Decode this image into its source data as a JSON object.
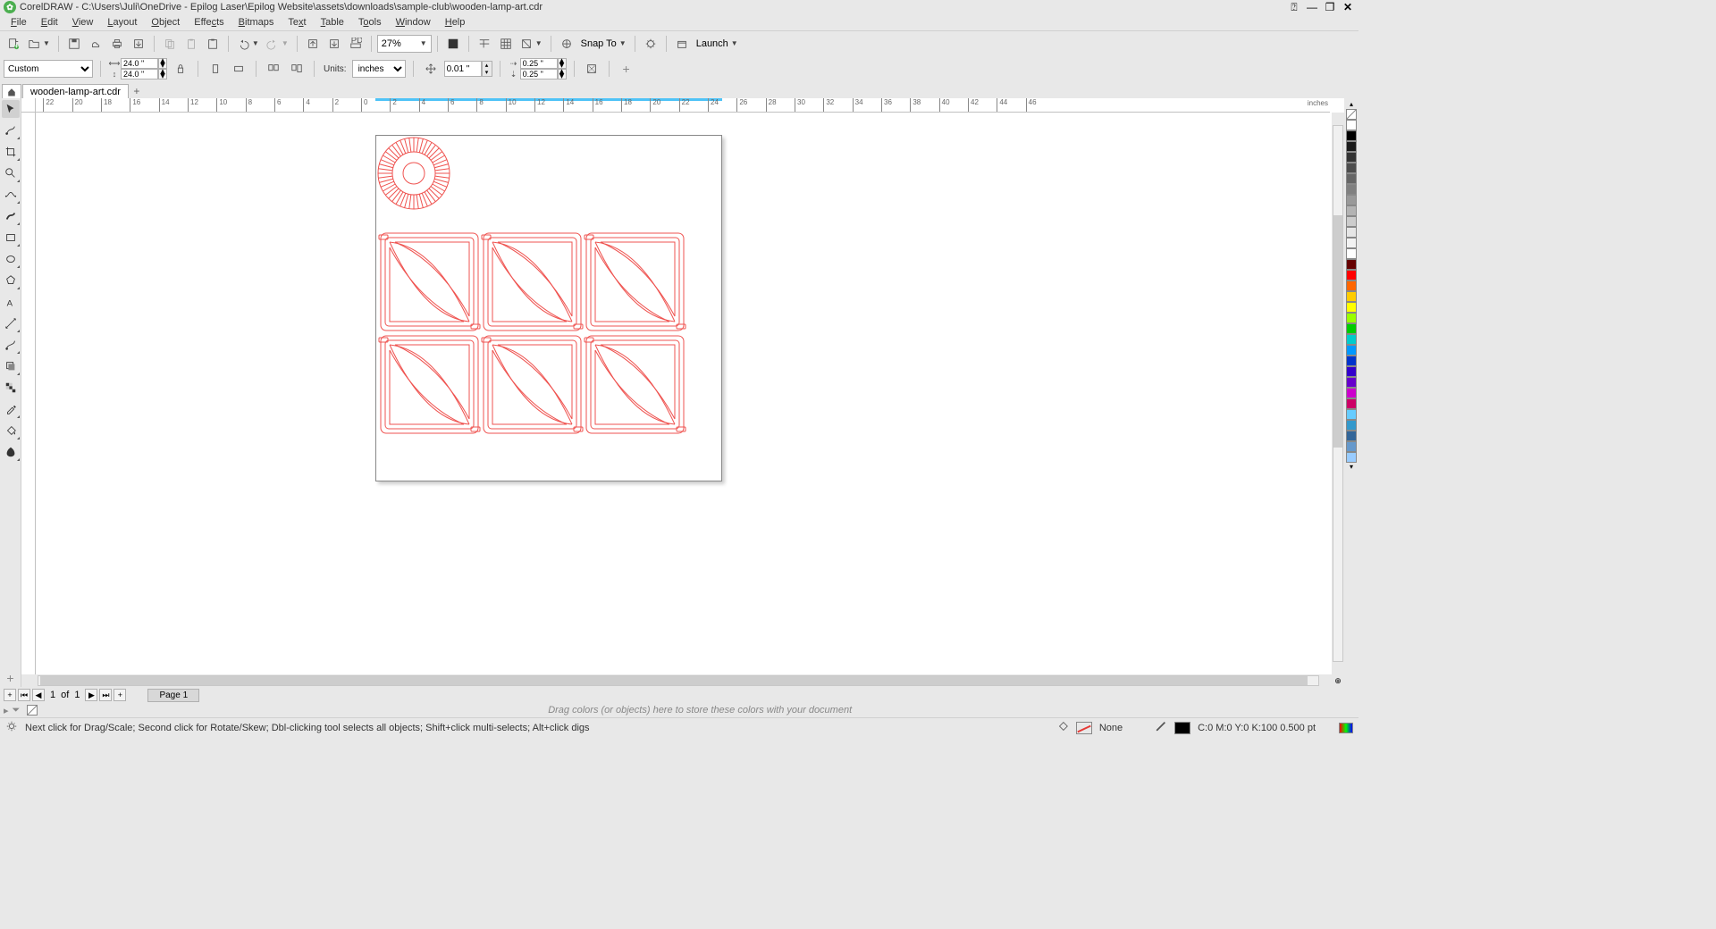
{
  "title": "CorelDRAW - C:\\Users\\Juli\\OneDrive - Epilog Laser\\Epilog Website\\assets\\downloads\\sample-club\\wooden-lamp-art.cdr",
  "menu": [
    "File",
    "Edit",
    "View",
    "Layout",
    "Object",
    "Effects",
    "Bitmaps",
    "Text",
    "Table",
    "Tools",
    "Window",
    "Help"
  ],
  "toolbar1": {
    "zoom": "27%",
    "snapto": "Snap To",
    "launch": "Launch"
  },
  "propbar": {
    "preset": "Custom",
    "width": "24.0 \"",
    "height": "24.0 \"",
    "units_label": "Units:",
    "units": "inches",
    "nudge": "0.01 \"",
    "dupx": "0.25 \"",
    "dupy": "0.25 \""
  },
  "tab": "wooden-lamp-art.cdr",
  "ruler_unit": "inches",
  "ruler_ticks": [
    -22,
    -20,
    -18,
    -16,
    -14,
    -12,
    -10,
    -8,
    -6,
    -4,
    -2,
    0,
    2,
    4,
    6,
    8,
    10,
    12,
    14,
    16,
    18,
    20,
    22,
    24,
    26,
    28,
    30,
    32,
    34,
    36,
    38,
    40,
    42,
    44,
    46
  ],
  "pagenav": {
    "current": "1",
    "of_label": "of",
    "total": "1",
    "page_tab": "Page 1"
  },
  "colorstore_hint": "Drag colors (or objects) here to store these colors with your document",
  "status": {
    "hint": "Next click for Drag/Scale; Second click for Rotate/Skew; Dbl-clicking tool selects all objects; Shift+click multi-selects; Alt+click digs",
    "fill_label": "None",
    "outline": "C:0 M:0 Y:0 K:100 0.500 pt"
  },
  "palette": [
    "#ffffff",
    "#000000",
    "#1a1a1a",
    "#333333",
    "#4d4d4d",
    "#666666",
    "#808080",
    "#999999",
    "#b3b3b3",
    "#cccccc",
    "#e6e6e6",
    "#f2f2f2",
    "#ffffff",
    "#660000",
    "#ff0000",
    "#ff6600",
    "#ffcc00",
    "#ffff00",
    "#99ff00",
    "#00cc00",
    "#00cccc",
    "#0099ff",
    "#0033cc",
    "#3300cc",
    "#6600cc",
    "#cc00cc",
    "#cc0066",
    "#66ccff",
    "#3399cc",
    "#336699",
    "#6699cc",
    "#99ccff"
  ]
}
